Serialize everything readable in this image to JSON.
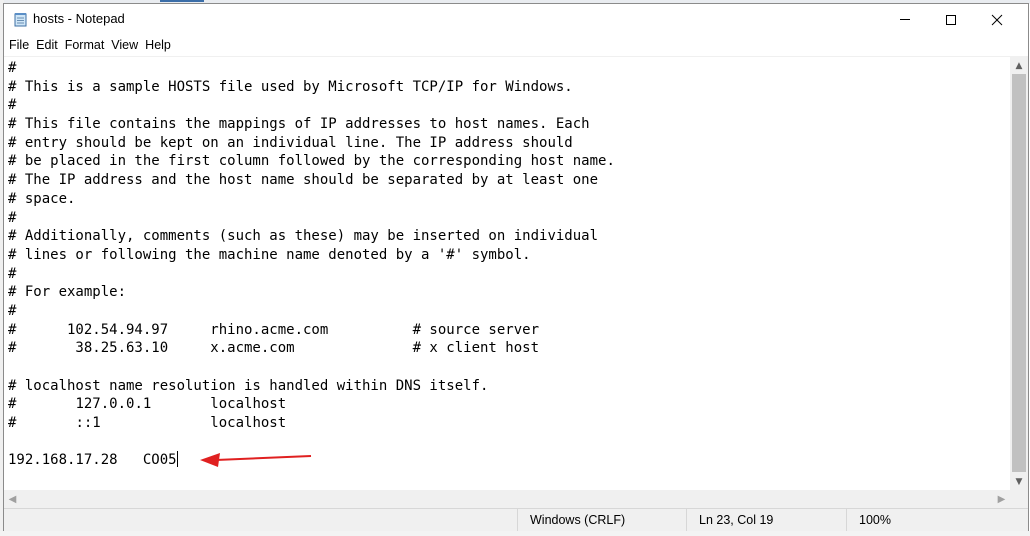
{
  "window": {
    "title": "hosts - Notepad"
  },
  "menu": {
    "items": [
      {
        "label": "File"
      },
      {
        "label": "Edit"
      },
      {
        "label": "Format"
      },
      {
        "label": "View"
      },
      {
        "label": "Help"
      }
    ]
  },
  "editor": {
    "lines": [
      "#",
      "# This is a sample HOSTS file used by Microsoft TCP/IP for Windows.",
      "#",
      "# This file contains the mappings of IP addresses to host names. Each",
      "# entry should be kept on an individual line. The IP address should",
      "# be placed in the first column followed by the corresponding host name.",
      "# The IP address and the host name should be separated by at least one",
      "# space.",
      "#",
      "# Additionally, comments (such as these) may be inserted on individual",
      "# lines or following the machine name denoted by a '#' symbol.",
      "#",
      "# For example:",
      "#",
      "#      102.54.94.97     rhino.acme.com          # source server",
      "#       38.25.63.10     x.acme.com              # x client host",
      "",
      "# localhost name resolution is handled within DNS itself.",
      "#\t127.0.0.1       localhost",
      "#\t::1             localhost",
      "",
      "192.168.17.28   CO05"
    ]
  },
  "status": {
    "line_ending": "Windows (CRLF)",
    "position": "Ln 23, Col 19",
    "zoom": "100%"
  },
  "colors": {
    "annotation_arrow": "#e02020",
    "scrollbar_thumb": "#c1c1c1",
    "statusbar_bg": "#f0f0f0"
  },
  "icons": {
    "app": "notepad-icon",
    "minimize": "minimize-icon",
    "maximize": "maximize-icon",
    "close": "close-icon"
  }
}
